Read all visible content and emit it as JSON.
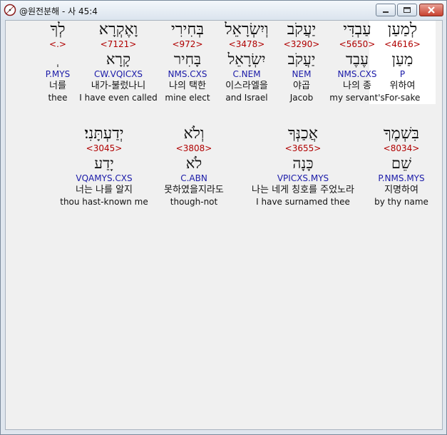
{
  "window": {
    "title": "@원전분해 - 사 45:4"
  },
  "icons": {
    "app": "app-compass-icon",
    "minimize": "minimize-icon",
    "maximize": "maximize-icon",
    "close": "close-icon"
  },
  "rows": [
    {
      "words": [
        {
          "hebrew": "לְמַעַן",
          "strong": "<4616>",
          "lemma": "מַעַן",
          "parse": "P",
          "korean": "위하여",
          "english": "For-sake",
          "highlight": true
        },
        {
          "hebrew": "עַבְדִּי",
          "strong": "<5650>",
          "lemma": "עֶבֶד",
          "parse": "NMS.CXS",
          "korean": "나의 종",
          "english": "my servant's",
          "highlight": false
        },
        {
          "hebrew": "יַעֲקֹב",
          "strong": "<3290>",
          "lemma": "יַעֲקֹב",
          "parse": "NEM",
          "korean": "야곱",
          "english": "Jacob",
          "highlight": false
        },
        {
          "hebrew": "וְיִשְׂרָאֵל",
          "strong": "<3478>",
          "lemma": "יִשְׂרָאֵל",
          "parse": "C.NEM",
          "korean": "이스라엘을",
          "english": "and Israel",
          "highlight": false
        },
        {
          "hebrew": "בְּחִירִי",
          "strong": "<972>",
          "lemma": "בָּחִיר",
          "parse": "NMS.CXS",
          "korean": "나의 택한",
          "english": "mine elect",
          "highlight": false
        },
        {
          "hebrew": "וָאֶקְרָא",
          "strong": "<7121>",
          "lemma": "קָרָא",
          "parse": "CW.VQICXS",
          "korean": "내가-불렀나니",
          "english": "I have even called",
          "highlight": false
        },
        {
          "hebrew": "לְךָ",
          "strong": "<.>",
          "lemma": "ְ",
          "parse": "P.MYS",
          "korean": "너를",
          "english": "thee",
          "highlight": false
        }
      ]
    },
    {
      "words": [
        {
          "hebrew": "בִּשְׁמֶךָ",
          "strong": "<8034>",
          "lemma": "שֵׁם",
          "parse": "P.NMS.MYS",
          "korean": "지명하여",
          "english": "by thy name",
          "highlight": false
        },
        {
          "hebrew": "אֲכַנְּךָ",
          "strong": "<3655>",
          "lemma": "כָּנָה",
          "parse": "VPICXS.MYS",
          "korean": "나는 네게 칭호를 주었노라",
          "english": "I have surnamed thee",
          "highlight": false
        },
        {
          "hebrew": "וְלֹא",
          "strong": "<3808>",
          "lemma": "לֹא",
          "parse": "C.ABN",
          "korean": "못하였을지라도",
          "english": "though-not",
          "highlight": false
        },
        {
          "hebrew": "יְדַעְתָּנִי׃",
          "strong": "<3045>",
          "lemma": "יָדַע",
          "parse": "VQAMYS.CXS",
          "korean": "너는 나를 알지",
          "english": "thou hast-known me",
          "highlight": false
        }
      ]
    }
  ]
}
